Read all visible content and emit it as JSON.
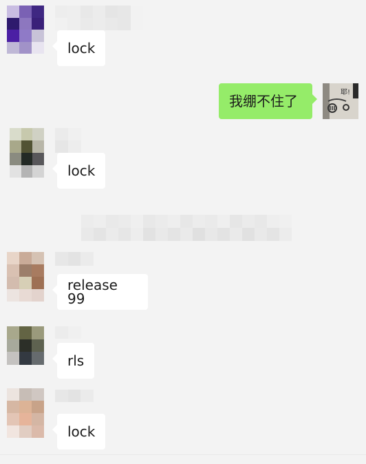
{
  "messages": [
    {
      "sender": "redacted",
      "text": "lock"
    },
    {
      "sender": "me",
      "text": "我绷不住了"
    },
    {
      "sender": "redacted",
      "text": "lock"
    },
    {
      "sender": "redacted",
      "text": "release 99"
    },
    {
      "sender": "redacted",
      "text": "rls"
    },
    {
      "sender": "redacted",
      "text": "lock"
    }
  ],
  "colors": {
    "background": "#f3f3f3",
    "received_bubble": "#ffffff",
    "sent_bubble": "#95ec69"
  },
  "avatars": [
    {
      "name": "avatar-purple",
      "tiles": [
        "#c9bde2",
        "#7a61b4",
        "#3f2782",
        "#2e1a6d",
        "#8d77bf",
        "#3a2079",
        "#4b1fa4",
        "#c8c3d8",
        "#bfb8d6",
        "#a192c8",
        "#9680cf",
        "#e8e4f0"
      ]
    },
    {
      "name": "avatar-olive",
      "tiles": [
        "#d9dccb",
        "#c7c9ad",
        "#d0d1c4",
        "#a8a88a",
        "#525334",
        "#b8b6a8",
        "#8a8b80",
        "#232a25",
        "#58575a",
        "#e2e2e2",
        "#b4b4b4",
        "#d4d4d4"
      ]
    },
    {
      "name": "avatar-beige",
      "tiles": [
        "#e8d5c8",
        "#c9ab98",
        "#d5c2b3",
        "#d9c1b2",
        "#9c7e6a",
        "#a87b60",
        "#d3bcae",
        "#d7cfb6",
        "#9e7054",
        "#ece4e0",
        "#e8dad4",
        "#e3d3cd"
      ]
    },
    {
      "name": "avatar-darkolive",
      "tiles": [
        "#a8a88c",
        "#636444",
        "#9a9a7c",
        "#a7a99c",
        "#2c2f28",
        "#5e6250",
        "#c4c2c0",
        "#333941",
        "#666b6e",
        "#f0f0f0",
        "#dedede",
        "#e8e8e8"
      ]
    },
    {
      "name": "avatar-skin",
      "tiles": [
        "#ece4df",
        "#c7bdb6",
        "#d0c7c2",
        "#d6b7a3",
        "#dcb396",
        "#c8a389",
        "#e3c5b5",
        "#e6b49a",
        "#d4b6a4",
        "#f1e5df",
        "#e1cdc2",
        "#dbbaaa"
      ]
    }
  ],
  "sticker": {
    "name": "sticker-face",
    "caption": "耶!"
  }
}
